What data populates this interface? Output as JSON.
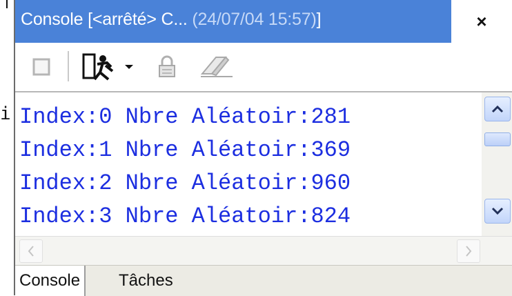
{
  "window": {
    "title_prefix": "Console [<arrêté> C...",
    "title_date": "(24/07/04 15:57)",
    "title_suffix": "]",
    "close_label": "×"
  },
  "toolbar": {
    "items": [
      "stop-icon",
      "run-icon",
      "dropdown-arrow-icon",
      "pin-lock-icon",
      "clear-eraser-icon"
    ]
  },
  "console": {
    "lines": [
      "Index:0 Nbre Aléatoir:281",
      "Index:1 Nbre Aléatoir:369",
      "Index:2 Nbre Aléatoir:960",
      "Index:3 Nbre Aléatoir:824"
    ],
    "text_color": "#1c2ee0"
  },
  "fragments": {
    "stray_mark": "i"
  },
  "tabs": [
    {
      "label": "Console",
      "active": true
    },
    {
      "label": "Tâches",
      "active": false
    }
  ],
  "colors": {
    "title_bar": "#4a82d8",
    "scrollbar_button": "#c2d5fa"
  }
}
